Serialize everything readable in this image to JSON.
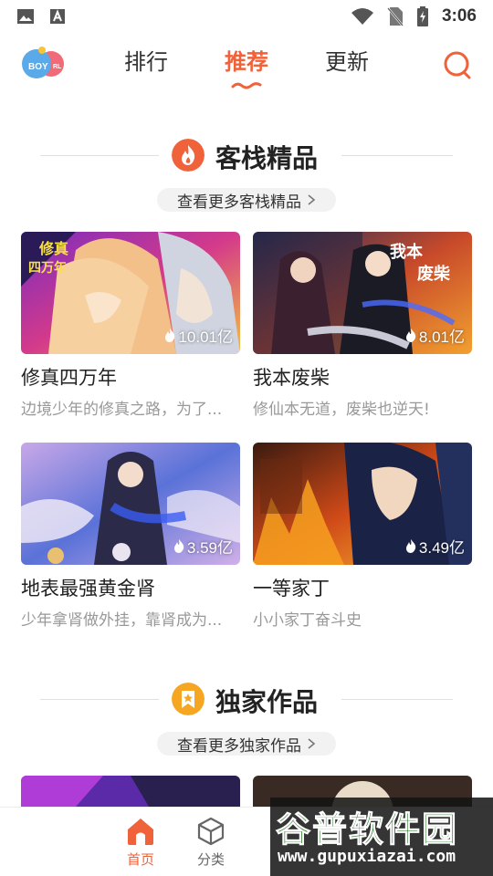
{
  "statusbar": {
    "time": "3:06"
  },
  "topnav": {
    "tabs": [
      {
        "label": "排行",
        "active": false
      },
      {
        "label": "推荐",
        "active": true
      },
      {
        "label": "更新",
        "active": false
      }
    ],
    "accent": "#f0623a"
  },
  "sections": [
    {
      "title": "客栈精品",
      "more_label": "查看更多客栈精品",
      "icon": "flame-icon",
      "items": [
        {
          "title": "修真四万年",
          "desc": "边境少年的修真之路，为了...",
          "heat": "10.01亿"
        },
        {
          "title": "我本废柴",
          "desc": "修仙本无道，废柴也逆天!",
          "heat": "8.01亿"
        },
        {
          "title": "地表最强黄金肾",
          "desc": "少年拿肾做外挂，靠肾成为...",
          "heat": "3.59亿"
        },
        {
          "title": "一等家丁",
          "desc": "小小家丁奋斗史",
          "heat": "3.49亿"
        }
      ]
    },
    {
      "title": "独家作品",
      "more_label": "查看更多独家作品",
      "icon": "bookmark-icon"
    }
  ],
  "bottomnav": {
    "items": [
      {
        "label": "首页",
        "icon": "home-icon",
        "active": true
      },
      {
        "label": "分类",
        "icon": "cube-icon",
        "active": false
      }
    ]
  },
  "watermark": {
    "title": "谷普软件园",
    "url": "www.gupuxiazai.com"
  }
}
